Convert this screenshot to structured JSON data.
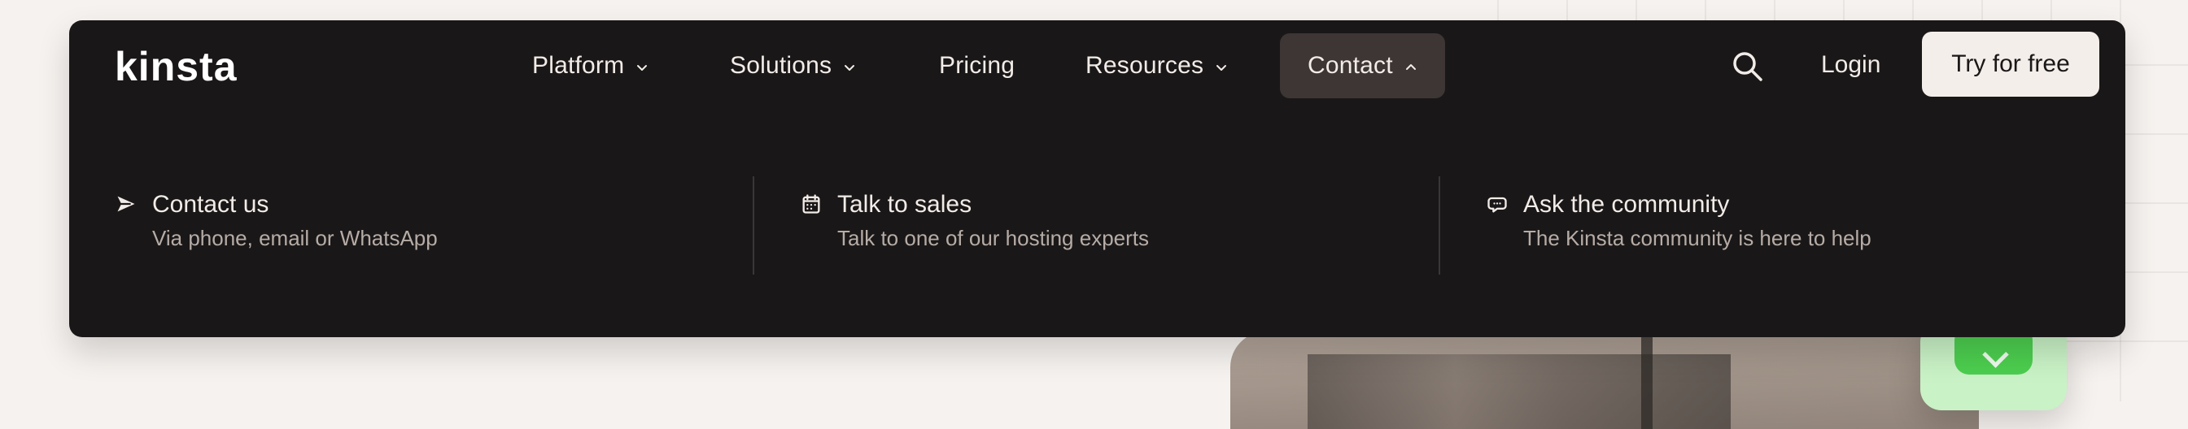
{
  "brand": {
    "logo_text": "kinsta"
  },
  "nav": {
    "items": [
      {
        "label": "Platform",
        "has_caret": true,
        "active": false
      },
      {
        "label": "Solutions",
        "has_caret": true,
        "active": false
      },
      {
        "label": "Pricing",
        "has_caret": false,
        "active": false
      },
      {
        "label": "Resources",
        "has_caret": true,
        "active": false
      },
      {
        "label": "Contact",
        "has_caret": true,
        "active": true
      }
    ],
    "search_icon": "search-icon",
    "login_label": "Login",
    "cta_label": "Try for free"
  },
  "contact_menu": {
    "columns": [
      {
        "icon": "send-icon",
        "title": "Contact us",
        "subtitle": "Via phone, email or WhatsApp"
      },
      {
        "icon": "calendar-icon",
        "title": "Talk to sales",
        "subtitle": "Talk to one of our hosting experts"
      },
      {
        "icon": "chat-bubble-icon",
        "title": "Ask the community",
        "subtitle": "The Kinsta community is here to help"
      }
    ]
  },
  "colors": {
    "page_bg": "#f6f2ef",
    "nav_bg": "#1a1718",
    "active_tab_bg": "#3d3634",
    "text_primary": "#f2ece8",
    "text_secondary": "#b6aca6",
    "cta_bg": "#f3eeea",
    "badge_green": "#4cce4f"
  }
}
